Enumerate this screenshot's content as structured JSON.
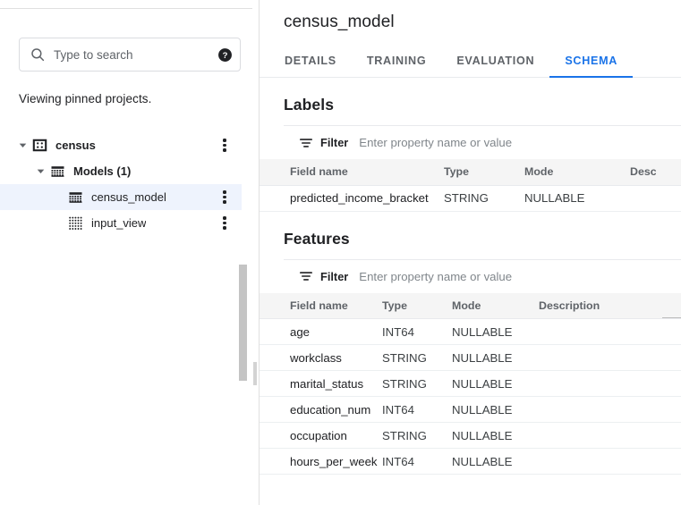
{
  "sidebar": {
    "search": {
      "placeholder": "Type to search",
      "value": "",
      "search_icon": "search-icon",
      "help_icon": "help-circle-icon"
    },
    "pinned_note": "Viewing pinned projects.",
    "tree": [
      {
        "label": "census",
        "icon": "project-icon",
        "indent": 0,
        "caret": "expanded",
        "selected": false,
        "menu": true,
        "bold": true
      },
      {
        "label": "Models (1)",
        "icon": "model-group-icon",
        "indent": 1,
        "caret": "expanded",
        "selected": false,
        "menu": false,
        "bold": true
      },
      {
        "label": "census_model",
        "icon": "model-icon",
        "indent": 2,
        "caret": "none",
        "selected": true,
        "menu": true,
        "bold": false
      },
      {
        "label": "input_view",
        "icon": "view-icon",
        "indent": 2,
        "caret": "none",
        "selected": false,
        "menu": true,
        "bold": false
      }
    ]
  },
  "main": {
    "title": "census_model",
    "tabs": [
      {
        "label": "DETAILS",
        "active": false
      },
      {
        "label": "TRAINING",
        "active": false
      },
      {
        "label": "EVALUATION",
        "active": false
      },
      {
        "label": "SCHEMA",
        "active": true
      }
    ],
    "active_tab": "SCHEMA",
    "sections": [
      {
        "heading": "Labels",
        "filter": {
          "label": "Filter",
          "placeholder": "Enter property name or value",
          "value": "",
          "icon": "filter-icon"
        },
        "columns": [
          "Field name",
          "Type",
          "Mode",
          "Description"
        ],
        "rows": [
          {
            "field_name": "predicted_income_bracket",
            "type": "STRING",
            "mode": "NULLABLE",
            "description": ""
          }
        ]
      },
      {
        "heading": "Features",
        "filter": {
          "label": "Filter",
          "placeholder": "Enter property name or value",
          "value": "",
          "icon": "filter-icon"
        },
        "columns": [
          "Field name",
          "Type",
          "Mode",
          "Description"
        ],
        "rows": [
          {
            "field_name": "age",
            "type": "INT64",
            "mode": "NULLABLE",
            "description": ""
          },
          {
            "field_name": "workclass",
            "type": "STRING",
            "mode": "NULLABLE",
            "description": ""
          },
          {
            "field_name": "marital_status",
            "type": "STRING",
            "mode": "NULLABLE",
            "description": ""
          },
          {
            "field_name": "education_num",
            "type": "INT64",
            "mode": "NULLABLE",
            "description": ""
          },
          {
            "field_name": "occupation",
            "type": "STRING",
            "mode": "NULLABLE",
            "description": ""
          },
          {
            "field_name": "hours_per_week",
            "type": "INT64",
            "mode": "NULLABLE",
            "description": ""
          }
        ]
      }
    ]
  },
  "colors": {
    "accent": "#1a73e8",
    "selected_row": "#eef3fd",
    "table_header_bg": "#f5f5f5",
    "text_primary": "#202124",
    "text_secondary": "#5f6368",
    "border": "#e0e0e0"
  }
}
